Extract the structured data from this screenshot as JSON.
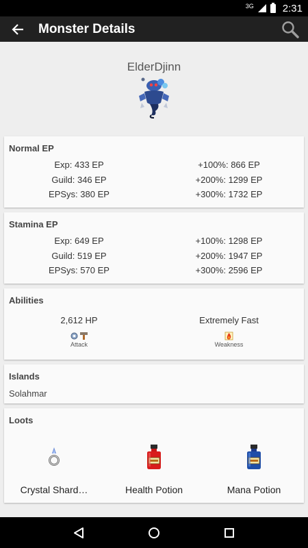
{
  "status": {
    "signal": "3G",
    "time": "2:31"
  },
  "app_bar": {
    "title": "Monster Details"
  },
  "monster": {
    "name": "ElderDjinn",
    "icon": "elder-djinn-sprite"
  },
  "normal_ep": {
    "title": "Normal EP",
    "rows": [
      {
        "left": "Exp: 433 EP",
        "right": "+100%: 866 EP"
      },
      {
        "left": "Guild: 346 EP",
        "right": "+200%: 1299 EP"
      },
      {
        "left": "EPSys: 380 EP",
        "right": "+300%: 1732 EP"
      }
    ]
  },
  "stamina_ep": {
    "title": "Stamina EP",
    "rows": [
      {
        "left": "Exp: 649 EP",
        "right": "+100%: 1298 EP"
      },
      {
        "left": "Guild: 519 EP",
        "right": "+200%: 1947 EP"
      },
      {
        "left": "EPSys: 570 EP",
        "right": "+300%: 2596 EP"
      }
    ]
  },
  "abilities": {
    "title": "Abilities",
    "hp": "2,612 HP",
    "speed": "Extremely Fast",
    "attack_label": "Attack",
    "weakness_label": "Weakness"
  },
  "islands": {
    "title": "Islands",
    "value": "Solahmar"
  },
  "loots": {
    "title": "Loots",
    "items": [
      {
        "name": "Crystal Shard…",
        "icon": "crystal-shard-icon"
      },
      {
        "name": "Health Potion",
        "icon": "health-potion-icon"
      },
      {
        "name": "Mana Potion",
        "icon": "mana-potion-icon"
      }
    ]
  },
  "colors": {
    "app_bar": "#212121",
    "background": "#eeeeee",
    "card": "#fafafa"
  }
}
